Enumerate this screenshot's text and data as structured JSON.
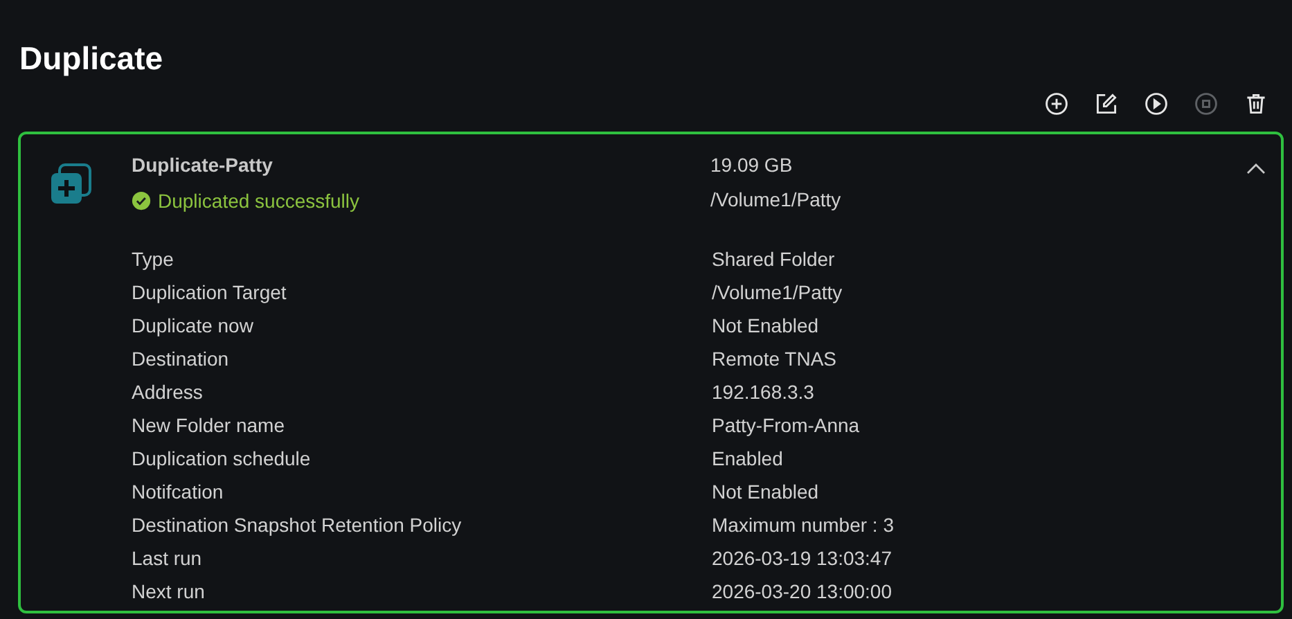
{
  "page": {
    "title": "Duplicate"
  },
  "toolbar": [
    {
      "kind": "add",
      "disabled": false
    },
    {
      "kind": "edit",
      "disabled": false
    },
    {
      "kind": "run",
      "disabled": false
    },
    {
      "kind": "stop",
      "disabled": true
    },
    {
      "kind": "delete",
      "disabled": false
    }
  ],
  "task": {
    "name": "Duplicate-Patty",
    "status": "Duplicated successfully",
    "size": "19.09 GB",
    "path": "/Volume1/Patty",
    "expanded": true,
    "selected": true,
    "details": [
      {
        "label": "Type",
        "value": "Shared Folder"
      },
      {
        "label": "Duplication Target",
        "value": "/Volume1/Patty"
      },
      {
        "label": "Duplicate now",
        "value": "Not Enabled"
      },
      {
        "label": "Destination",
        "value": "Remote TNAS"
      },
      {
        "label": "Address",
        "value": "192.168.3.3"
      },
      {
        "label": "New Folder name",
        "value": "Patty-From-Anna"
      },
      {
        "label": "Duplication schedule",
        "value": "Enabled"
      },
      {
        "label": "Notifcation",
        "value": "Not Enabled"
      },
      {
        "label": "Destination Snapshot Retention Policy",
        "value": "Maximum number : 3"
      },
      {
        "label": "Last run",
        "value": "2026-03-19 13:03:47"
      },
      {
        "label": "Next run",
        "value": "2026-03-20 13:00:00"
      }
    ]
  }
}
